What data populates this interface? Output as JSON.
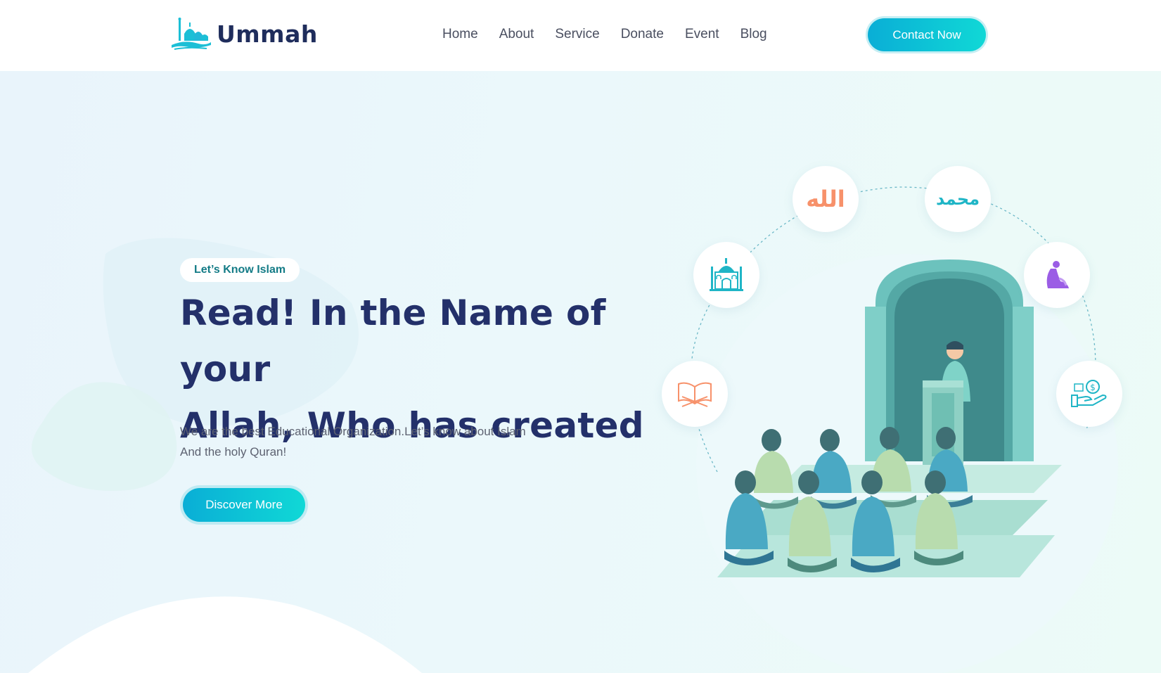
{
  "header": {
    "logo_text": "Ummah",
    "nav": [
      "Home",
      "About",
      "Service",
      "Donate",
      "Event",
      "Blog"
    ],
    "contact_label": "Contact Now"
  },
  "hero": {
    "tag": "Let’s Know Islam",
    "title_lines": [
      "Read! In the Name of your",
      "Allah, Who has created"
    ],
    "desc_lines": [
      "We are the best Educational Organization.Let’s know about Islam",
      "And the holy Quran!"
    ],
    "button_label": "Discover More"
  },
  "orbit_icons": {
    "allah_text": "الله",
    "muhammad_text": "محمد",
    "items": [
      "mosque-icon",
      "allah-calligraphy-icon",
      "muhammad-calligraphy-icon",
      "prayer-icon",
      "quran-icon",
      "charity-icon"
    ]
  },
  "colors": {
    "brand_dark": "#23306a",
    "accent_start": "#0aaed6",
    "accent_end": "#10d8d6",
    "tag_text": "#137b86",
    "allah_orange": "#f7916a",
    "muhammad_teal": "#1fb5c6",
    "prayer_purple": "#9b5de5"
  }
}
